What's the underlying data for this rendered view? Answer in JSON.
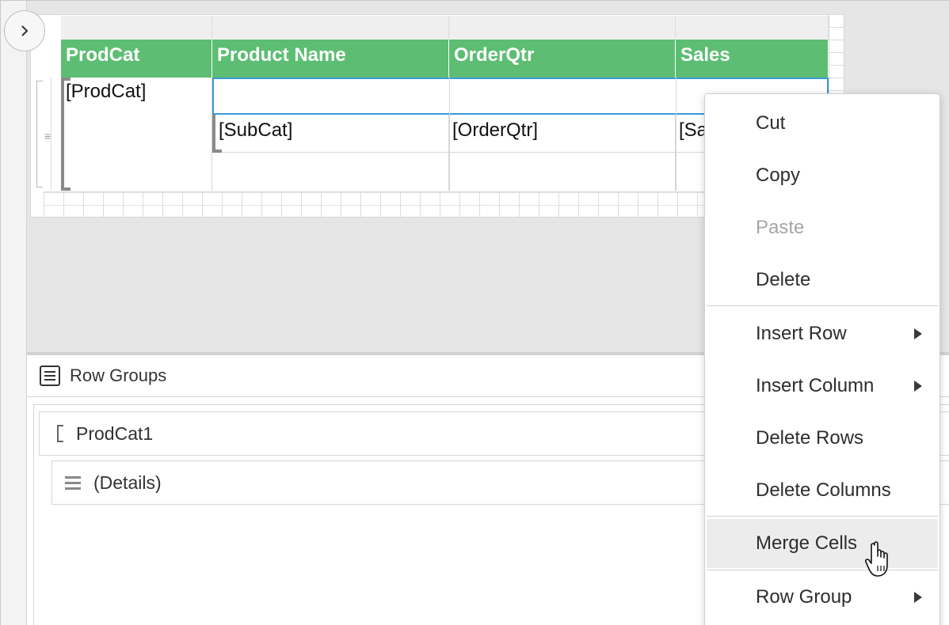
{
  "designer": {
    "toggle_icon": "chevron-right-icon",
    "table": {
      "headers": [
        "ProdCat",
        "Product Name",
        "OrderQtr",
        "Sales"
      ],
      "header_color": "#5dbe73",
      "group_cell": "[ProdCat]",
      "detail_cells": [
        "[SubCat]",
        "[OrderQtr]",
        "[Sa"
      ],
      "selection_color": "#3b9ad9"
    }
  },
  "row_groups": {
    "title": "Row Groups",
    "icon": "list-icon",
    "items": [
      {
        "label": "ProdCat1",
        "icon": "bracket-icon"
      },
      {
        "label": "(Details)",
        "icon": "details-lines-icon"
      }
    ]
  },
  "context_menu": {
    "items": [
      {
        "label": "Cut",
        "disabled": false
      },
      {
        "label": "Copy",
        "disabled": false
      },
      {
        "label": "Paste",
        "disabled": true
      },
      {
        "label": "Delete",
        "disabled": false
      },
      {
        "label": "Insert Row",
        "submenu": true
      },
      {
        "label": "Insert Column",
        "submenu": true
      },
      {
        "label": "Delete Rows"
      },
      {
        "label": "Delete Columns"
      },
      {
        "label": "Merge Cells",
        "hovered": true
      },
      {
        "label": "Row Group",
        "submenu": true
      }
    ]
  }
}
